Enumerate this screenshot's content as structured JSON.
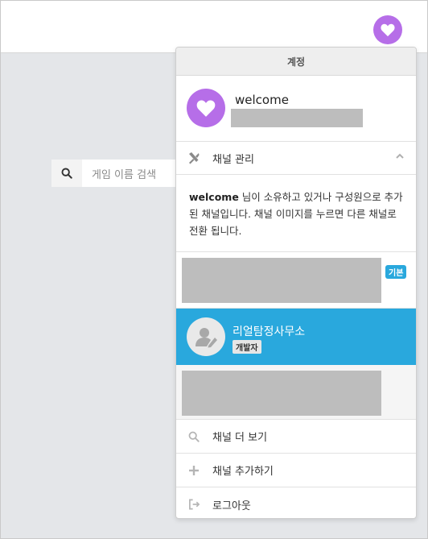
{
  "header": {
    "avatar_icon": "heart-icon",
    "avatar_color": "#b66ee8"
  },
  "search": {
    "placeholder": "게임 이름 검색",
    "icon": "search-icon"
  },
  "panel": {
    "title": "계정",
    "profile": {
      "name": "welcome",
      "avatar_icon": "heart-icon"
    },
    "manage": {
      "label": "채널 관리",
      "icon": "tools-icon",
      "expanded": true
    },
    "description": {
      "name": "welcome",
      "text": " 님이 소유하고 있거나 구성원으로 추가된 채널입니다. 채널 이미지를 누르면 다른 채널로 전환 됩니다."
    },
    "channels": [
      {
        "badge": "기본"
      },
      {
        "name": "리얼탐정사무소",
        "role": "개발자",
        "active": true
      },
      {}
    ],
    "menu": [
      {
        "label": "채널 더 보기",
        "icon": "search-icon"
      },
      {
        "label": "채널 추가하기",
        "icon": "plus-icon"
      },
      {
        "label": "로그아웃",
        "icon": "logout-icon"
      }
    ]
  },
  "colors": {
    "accent": "#29a8dd",
    "avatar": "#b66ee8"
  }
}
